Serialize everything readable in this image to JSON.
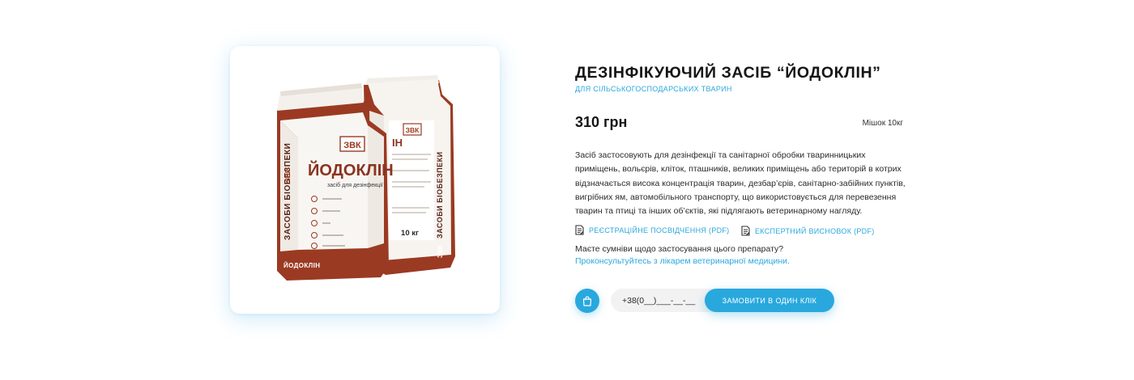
{
  "product": {
    "title": "ДЕЗІНФІКУЮЧИЙ ЗАСІБ “ЙОДОКЛІН”",
    "subtitle": "ДЛЯ СІЛЬСЬКОГОСПОДАРСЬКИХ ТВАРИН",
    "price": "310 грн",
    "package": "Мішок 10кг",
    "description": "Засіб застосовують для дезінфекції та санітарної обробки тваринницьких приміщень, вольєрів, кліток, пташників, великих приміщень або територій в котрих відзначається висока концентрація тварин, дезбар’єрів, санітарно-забійних пунктів, вигрібних ям, автомобільного транспорту, що використовується для перевезення тварин та птиці та інших об’єктів, які підлягають ветеринарному нагляду."
  },
  "image": {
    "brand": "ЗВК",
    "name": "ЙОДОКЛІН",
    "purpose": "засіб для дезінфекції",
    "side_text": "ЗАСОБИ БІОБЕЗПЕКИ",
    "bottom_text": "ЙОДОКЛІН",
    "weight": "10 кг",
    "back_name": "ІН"
  },
  "documents": [
    {
      "label": "РЕЄСТРАЦІЙНЕ ПОСВІДЧЕННЯ (PDF)",
      "icon": "document-icon"
    },
    {
      "label": "ЕКСПЕРТНИЙ ВИСНОВОК (PDF)",
      "icon": "document-icon"
    }
  ],
  "consult": {
    "question": "Маєте сумніви щодо застосування цього препарату?",
    "link": "Проконсультуйтесь з лікарем ветеринарної медицини."
  },
  "order": {
    "phone_placeholder": "+38(0__)___-__-__",
    "button_label": "ЗАМОВИТИ В ОДИН КЛІК",
    "cart_icon": "shopping-bag-icon"
  },
  "colors": {
    "accent": "#29a8de",
    "bag_red": "#9b3a22",
    "text": "#151515"
  }
}
